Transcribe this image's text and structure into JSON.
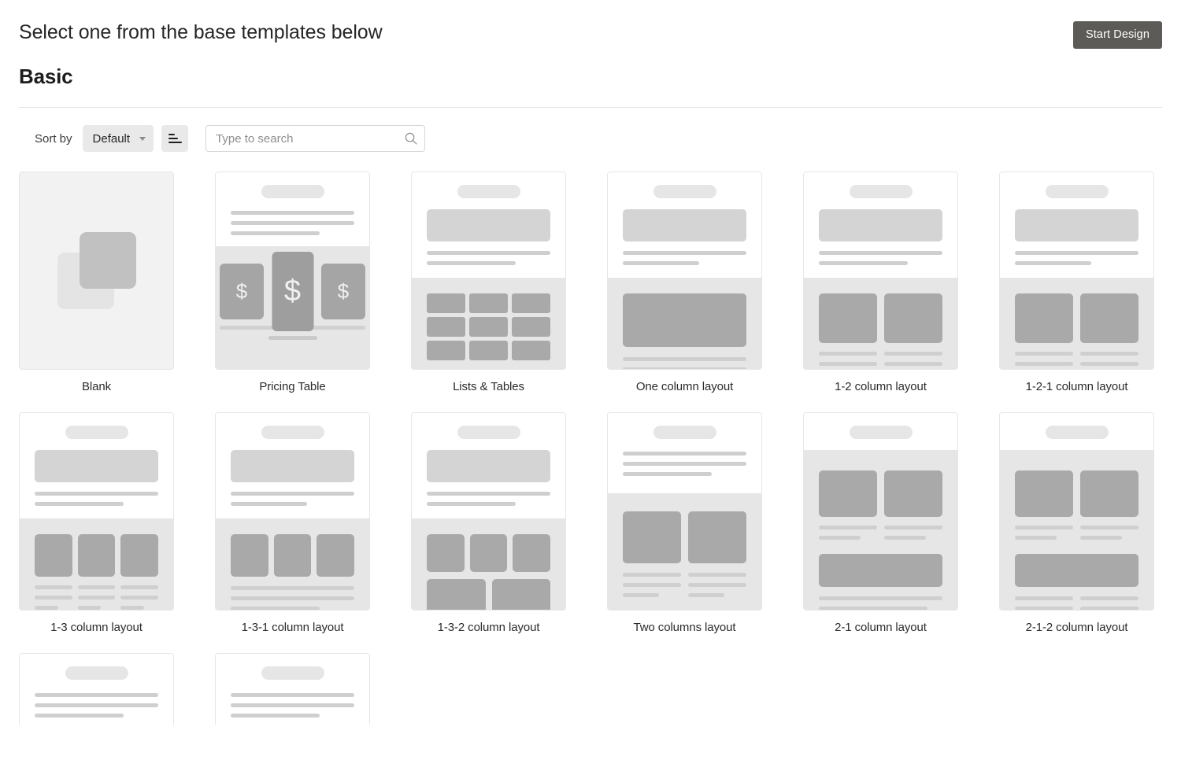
{
  "header": {
    "title": "Select one from the base templates below",
    "section": "Basic",
    "start_design_label": "Start Design"
  },
  "toolbar": {
    "sort_by_label": "Sort by",
    "sort_value": "Default",
    "sort_options": [
      "Default"
    ],
    "sort_direction_icon": "sort-ascending-icon",
    "caret_icon": "chevron-down-icon",
    "search_placeholder": "Type to search",
    "search_value": "",
    "search_icon": "search-icon"
  },
  "colors": {
    "accent_button": "#5d5b57",
    "card_border": "#e6e6e6",
    "wireframe_block": "#a9a9a9",
    "wireframe_hero": "#d4d4d4",
    "wireframe_line": "#cfcfcf",
    "wireframe_panel": "#e6e6e6",
    "blank_background": "#f2f2f2"
  },
  "templates": [
    {
      "label": "Blank",
      "kind": "blank"
    },
    {
      "label": "Pricing Table",
      "kind": "pricing",
      "currency": "$"
    },
    {
      "label": "Lists & Tables",
      "kind": "lists"
    },
    {
      "label": "One column layout",
      "kind": "one-col"
    },
    {
      "label": "1-2 column layout",
      "kind": "one-two"
    },
    {
      "label": "1-2-1 column layout",
      "kind": "one-two-one"
    },
    {
      "label": "1-3 column layout",
      "kind": "one-three"
    },
    {
      "label": "1-3-1 column layout",
      "kind": "one-three-one"
    },
    {
      "label": "1-3-2 column layout",
      "kind": "one-three-two"
    },
    {
      "label": "Two columns layout",
      "kind": "two-cols"
    },
    {
      "label": "2-1 column layout",
      "kind": "two-one"
    },
    {
      "label": "2-1-2 column layout",
      "kind": "two-one-two"
    }
  ],
  "partial_row": [
    {
      "kind": "text-header"
    },
    {
      "kind": "text-header"
    }
  ]
}
